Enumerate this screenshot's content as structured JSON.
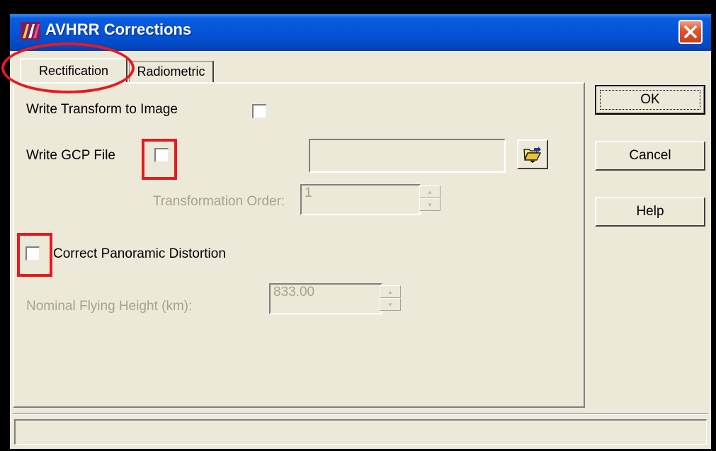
{
  "window": {
    "title": "AVHRR Corrections"
  },
  "tabs": [
    {
      "label": "Rectification",
      "selected": true
    },
    {
      "label": "Radiometric",
      "selected": false
    }
  ],
  "rectification": {
    "write_transform_label": "Write Transform to Image",
    "write_transform_checked": false,
    "write_gcp_label": "Write GCP File",
    "write_gcp_checked": false,
    "gcp_file_path": "",
    "transformation_order_label": "Transformation Order:",
    "transformation_order_value": "1",
    "correct_panoramic_label": "Correct Panoramic Distortion",
    "correct_panoramic_checked": false,
    "flying_height_label": "Nominal Flying Height (km):",
    "flying_height_value": "833.00"
  },
  "buttons": {
    "ok": "OK",
    "cancel": "Cancel",
    "help": "Help"
  },
  "status": {
    "text": ""
  },
  "icons": {
    "close": "close-icon",
    "app": "avhrr-app-icon",
    "browse": "folder-open-icon"
  },
  "colors": {
    "title_bar": "#0454d6",
    "close_button": "#e0582d",
    "annotation_red": "#e8191f",
    "dialog_bg": "#ece9d8"
  }
}
